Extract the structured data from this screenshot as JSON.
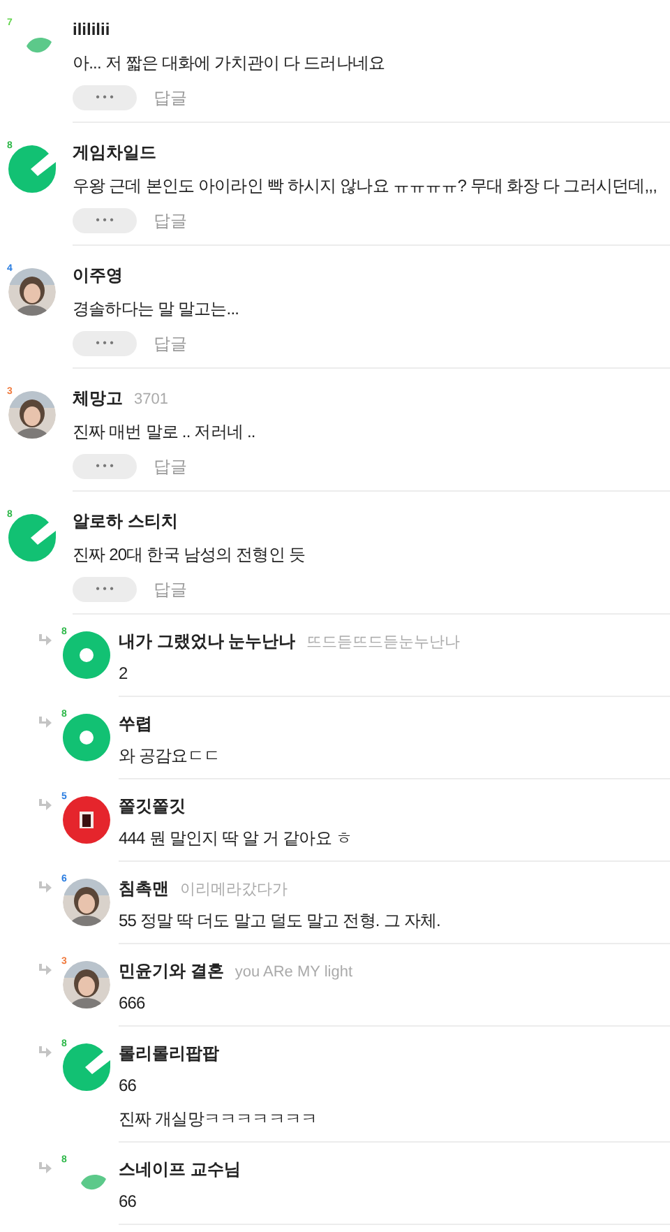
{
  "comments": [
    {
      "avatar": {
        "kind": "leaf",
        "badge": "7",
        "color": "#5fd34a"
      },
      "name": "ilililii",
      "lines": [
        "아... 저 짧은 대화에 가치관이 다 드러나네요"
      ],
      "menu": "• • •",
      "reply": "답글"
    },
    {
      "avatar": {
        "kind": "pac",
        "badge": "8",
        "color": "#2fb84a"
      },
      "name": "게임차일드",
      "lines": [
        "우왕 근데 본인도 아이라인 빡 하시지 않나요 ㅠㅠㅠㅠ? 무대 화장 다 그러시던데,,,"
      ],
      "menu": "• • •",
      "reply": "답글"
    },
    {
      "avatar": {
        "badge": "4",
        "color": "#2a7de1"
      },
      "name": "이주영",
      "lines": [
        "경솔하다는 말 말고는..."
      ],
      "menu": "• • •",
      "reply": "답글"
    },
    {
      "avatar": {
        "badge": "3",
        "color": "#f07b3f"
      },
      "name": "체망고",
      "subname": "3701",
      "lines": [
        "진짜 매번 말로 .. 저러네 .."
      ],
      "menu": "• • •",
      "reply": "답글"
    },
    {
      "avatar": {
        "kind": "pac",
        "badge": "8",
        "color": "#2fb84a"
      },
      "name": "알로하 스티치",
      "lines": [
        "진짜 20대 한국 남성의 전형인 듯"
      ],
      "menu": "• • •",
      "reply": "답글",
      "replies": [
        {
          "avatar": {
            "kind": "ring",
            "badge": "8",
            "color": "#2fb84a"
          },
          "name": "내가 그랬었나 눈누난나",
          "subname": "뜨드듣뜨드듣눈누난나",
          "lines": [
            "2"
          ]
        },
        {
          "avatar": {
            "kind": "ring",
            "badge": "8",
            "color": "#2fb84a"
          },
          "name": "쑤렵",
          "lines": [
            "와 공감요ㄷㄷ"
          ]
        },
        {
          "avatar": {
            "kind": "red",
            "badge": "5",
            "color": "#2a7de1"
          },
          "name": "쫄깃쫄깃",
          "lines": [
            "444 뭔 말인지 딱 알 거 같아요 ㅎ"
          ]
        },
        {
          "avatar": {
            "badge": "6",
            "color": "#2a7de1"
          },
          "name": "침촉맨",
          "subname": "이리메라갔다가",
          "lines": [
            "55 정말 딱 더도 말고 덜도 말고 전형. 그 자체."
          ]
        },
        {
          "avatar": {
            "badge": "3",
            "color": "#f07b3f"
          },
          "name": "민윤기와 결혼",
          "subname": "you ARe MY light",
          "lines": [
            "666"
          ]
        },
        {
          "avatar": {
            "kind": "pac",
            "badge": "8",
            "color": "#2fb84a"
          },
          "name": "롤리롤리팝팝",
          "lines": [
            "66",
            "진짜 개실망ㅋㅋㅋㅋㅋㅋㅋ"
          ]
        },
        {
          "avatar": {
            "kind": "leaf",
            "badge": "8",
            "color": "#2fb84a"
          },
          "name": "스네이프 교수님",
          "lines": [
            "66"
          ]
        }
      ]
    }
  ]
}
